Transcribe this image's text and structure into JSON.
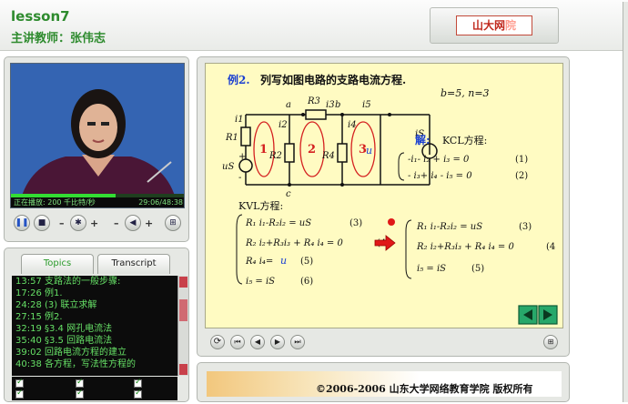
{
  "header": {
    "lesson": "lesson7",
    "teacher": "主讲教师：张伟志",
    "logo": "山大网",
    "logo_faint": "院"
  },
  "video": {
    "status_left": "正在播放: 200 千比特/秒",
    "status_right": "29:06/48:38",
    "progress": 0.6
  },
  "tabs": {
    "topics": "Topics",
    "transcript": "Transcript"
  },
  "topics": [
    "13:57 支路法的一般步骤:",
    "17:26 例1.",
    "24:28 (3) 联立求解",
    "27:15 例2.",
    "32:19 §3.4 网孔电流法",
    "35:40 §3.5 回路电流法",
    "39:02 回路电流方程的建立",
    "40:38 各方程，写法性方程的"
  ],
  "slide": {
    "title_ex": "例2.",
    "title_rest": "列写如图电路的支路电流方程.",
    "params": "b=5,  n=3",
    "solution": "解:",
    "kcl_label": "KCL方程:",
    "kvl_label": "KVL方程:",
    "kcl1": "-i₁- i₂ + i₃ = 0",
    "kcl1_n": "(1)",
    "kcl2": "- i₃+ i₄ - i₅ = 0",
    "kcl2_n": "(2)",
    "kvl_a1": "R₁ i₁-R₂i₂ = uS",
    "kvl_a1_n": "(3)",
    "kvl_a2": "R₂ i₂+R₃i₃ + R₄ i₄ = 0",
    "kvl_a2_n": "(4)",
    "kvl_a3_pre": "R₄ i₄=",
    "kvl_a3_u": "u",
    "kvl_a3_n": "(5)",
    "kvl_a4": "i₅ = iS",
    "kvl_a4_n": "(6)",
    "kvl_b1": "R₁ i₁-R₂i₂ = uS",
    "kvl_b1_n": "(3)",
    "kvl_b2": "R₂ i₂+R₃i₃ + R₄ i₄ = 0",
    "kvl_b2_n": "(4",
    "kvl_b3": "i₅ = iS",
    "kvl_b3_n": "(5)",
    "circuit": {
      "node_a": "a",
      "node_b": "b",
      "node_c": "c",
      "R1": "R1",
      "R2": "R2",
      "R3": "R3",
      "R4": "R4",
      "i1": "i1",
      "i2": "i2",
      "i3": "i3",
      "i4": "i4",
      "i5": "i5",
      "us": "uS",
      "is": "iS",
      "u": "u",
      "loop1": "1",
      "loop2": "2",
      "loop3": "3",
      "plus": "+",
      "minus": "-"
    }
  },
  "footer": {
    "copyright": "©2006-2006  山东大学网络教育学院 版权所有"
  },
  "colors": {
    "green_text": "#2e8b2e",
    "list_text": "#66e066",
    "slide_bg": "#fffbc2",
    "title_blue": "#1a3fd1",
    "loop_red": "#d42020"
  }
}
